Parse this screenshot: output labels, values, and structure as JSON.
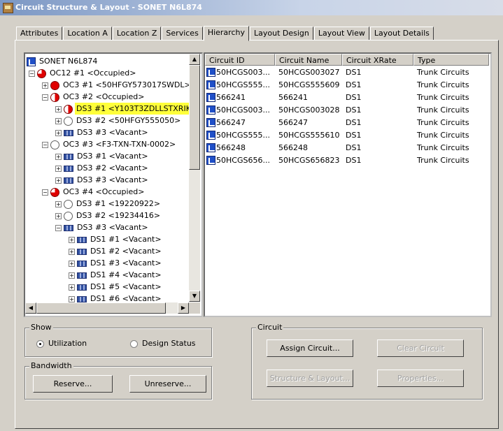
{
  "window": {
    "title": "Circuit Structure & Layout - SONET N6L874"
  },
  "tabs": [
    "Attributes",
    "Location A",
    "Location Z",
    "Services",
    "Hierarchy",
    "Layout Design",
    "Layout View",
    "Layout Details"
  ],
  "active_tab": "Hierarchy",
  "tree": [
    {
      "label": "SONET N6L874",
      "icon": "sonet-icon",
      "indent": 0,
      "expander": ""
    },
    {
      "label": "OC12 #1 <Occupied>",
      "icon": "threequarter-circle-icon",
      "indent": 1,
      "expander": "-"
    },
    {
      "label": "OC3 #1 <50HFGY573017SWDL>",
      "icon": "full-circle-icon",
      "indent": 2,
      "expander": "+"
    },
    {
      "label": "OC3 #2 <Occupied>",
      "icon": "half-circle-icon",
      "indent": 2,
      "expander": "-"
    },
    {
      "label": "DS3 #1 <Y103T3ZDLLSTXRIK",
      "icon": "half-circle-icon",
      "indent": 3,
      "expander": "+",
      "highlight": true
    },
    {
      "label": "DS3 #2 <50HFGY555050>",
      "icon": "empty-circle-icon",
      "indent": 3,
      "expander": "+"
    },
    {
      "label": "DS3 #3 <Vacant>",
      "icon": "vacant-icon",
      "indent": 3,
      "expander": "+"
    },
    {
      "label": "OC3 #3 <F3-TXN-TXN-0002>",
      "icon": "empty-circle-icon",
      "indent": 2,
      "expander": "-"
    },
    {
      "label": "DS3 #1 <Vacant>",
      "icon": "vacant-icon",
      "indent": 3,
      "expander": "+"
    },
    {
      "label": "DS3 #2 <Vacant>",
      "icon": "vacant-icon",
      "indent": 3,
      "expander": "+"
    },
    {
      "label": "DS3 #3 <Vacant>",
      "icon": "vacant-icon",
      "indent": 3,
      "expander": "+"
    },
    {
      "label": "OC3 #4 <Occupied>",
      "icon": "threequarter-circle-icon",
      "indent": 2,
      "expander": "-"
    },
    {
      "label": "DS3 #1 <19220922>",
      "icon": "empty-circle-icon",
      "indent": 3,
      "expander": "+"
    },
    {
      "label": "DS3 #2 <19234416>",
      "icon": "empty-circle-icon",
      "indent": 3,
      "expander": "+"
    },
    {
      "label": "DS3 #3 <Vacant>",
      "icon": "vacant-icon",
      "indent": 3,
      "expander": "-"
    },
    {
      "label": "DS1 #1 <Vacant>",
      "icon": "vacant-icon",
      "indent": 4,
      "expander": "+"
    },
    {
      "label": "DS1 #2 <Vacant>",
      "icon": "vacant-icon",
      "indent": 4,
      "expander": "+"
    },
    {
      "label": "DS1 #3 <Vacant>",
      "icon": "vacant-icon",
      "indent": 4,
      "expander": "+"
    },
    {
      "label": "DS1 #4 <Vacant>",
      "icon": "vacant-icon",
      "indent": 4,
      "expander": "+"
    },
    {
      "label": "DS1 #5 <Vacant>",
      "icon": "vacant-icon",
      "indent": 4,
      "expander": "+"
    },
    {
      "label": "DS1 #6 <Vacant>",
      "icon": "vacant-icon",
      "indent": 4,
      "expander": "+"
    }
  ],
  "list": {
    "columns": [
      "Circuit ID",
      "Circuit Name",
      "Circuit XRate",
      "Type"
    ],
    "rows": [
      [
        "50HCGS003...",
        "50HCGS003027",
        "DS1",
        "Trunk Circuits"
      ],
      [
        "50HCGS555...",
        "50HCGS555609",
        "DS1",
        "Trunk Circuits"
      ],
      [
        "566241",
        "566241",
        "DS1",
        "Trunk Circuits"
      ],
      [
        "50HCGS003...",
        "50HCGS003028",
        "DS1",
        "Trunk Circuits"
      ],
      [
        "566247",
        "566247",
        "DS1",
        "Trunk Circuits"
      ],
      [
        "50HCGS555...",
        "50HCGS555610",
        "DS1",
        "Trunk Circuits"
      ],
      [
        "566248",
        "566248",
        "DS1",
        "Trunk Circuits"
      ],
      [
        "50HCGS656...",
        "50HCGS656823",
        "DS1",
        "Trunk Circuits"
      ]
    ]
  },
  "show": {
    "label": "Show",
    "utilization": "Utilization",
    "design_status": "Design Status",
    "selected": "Utilization"
  },
  "bandwidth": {
    "label": "Bandwidth",
    "reserve": "Reserve...",
    "unreserve": "Unreserve..."
  },
  "circuit": {
    "label": "Circuit",
    "assign": "Assign Circuit...",
    "clear": "Clear Circuit",
    "structure": "Structure & Layout...",
    "properties": "Properties..."
  },
  "colors": {
    "highlight": "#ffff3a",
    "occupied": "#e00000",
    "sonet": "#2050c8"
  }
}
